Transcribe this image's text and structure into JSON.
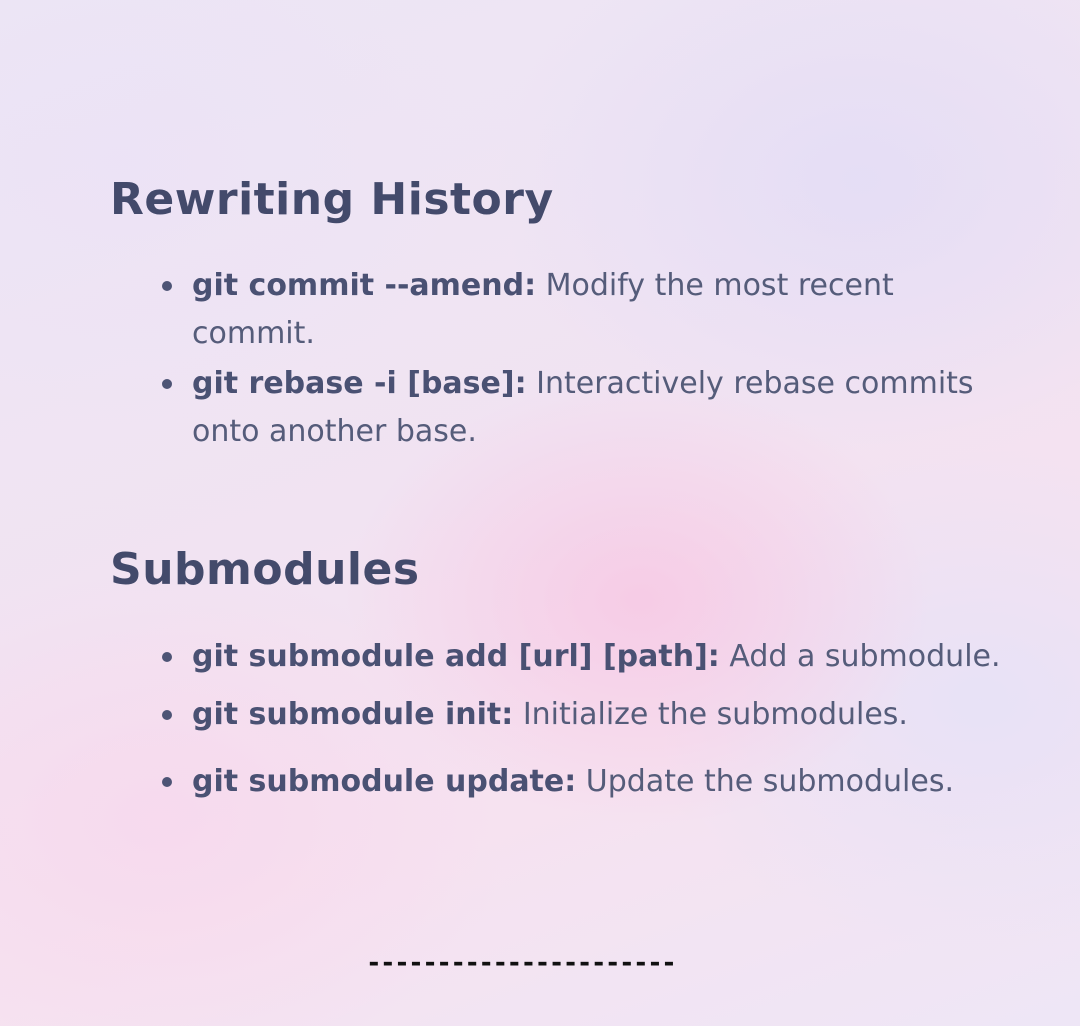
{
  "sections": [
    {
      "title": "Rewriting History",
      "items": [
        {
          "command": "git commit --amend:",
          "description": " Modify the most recent commit."
        },
        {
          "command": "git rebase -i [base]:",
          "description": " Interactively rebase commits onto another base."
        }
      ]
    },
    {
      "title": "Submodules",
      "items": [
        {
          "command": "git submodule add [url] [path]:",
          "description": " Add a submodule."
        },
        {
          "command": "git submodule init:",
          "description": " Initialize the submodules."
        },
        {
          "command": "git submodule update:",
          "description": " Update the submodules."
        }
      ]
    }
  ],
  "divider": "----------------------"
}
